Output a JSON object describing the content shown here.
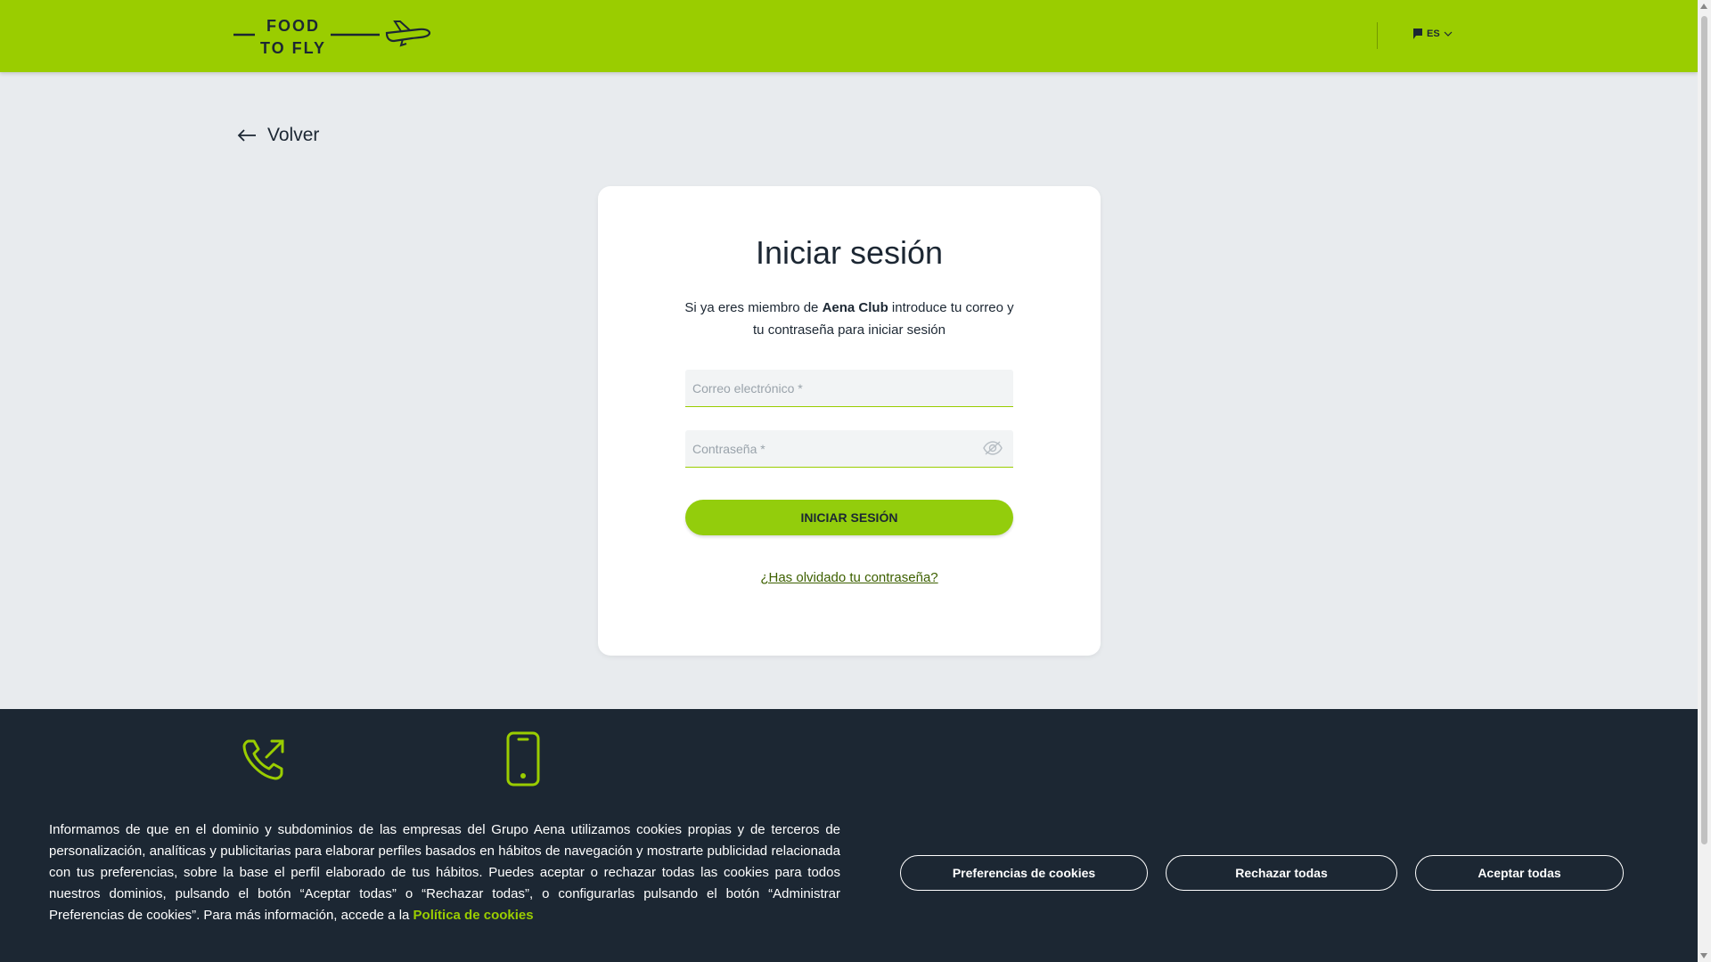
{
  "header": {
    "logo_line1": "FOOD",
    "logo_line2": "TO FLY",
    "language": "ES"
  },
  "back_label": "Volver",
  "login": {
    "title": "Iniciar sesión",
    "desc_before": "Si ya eres miembro de ",
    "desc_brand": "Aena Club",
    "desc_after": " introduce tu correo y tu contraseña para iniciar sesión",
    "email_placeholder": "Correo electrónico *",
    "password_placeholder": "Contraseña *",
    "submit_label": "INICIAR SESIÓN",
    "forgot_label": "¿Has olvidado tu contraseña?"
  },
  "cookies": {
    "text": "Informamos de que en el dominio y subdominios de las empresas del Grupo Aena utilizamos cookies propias y de terceros de personalización, analíticas y publicitarias para elaborar perfiles basados en hábitos de navegación y mostrarte publicidad relacionada con tus preferencias, sobre la base el perfil elaborado de tus hábitos. Puedes aceptar o rechazar todas las cookies para todos nuestros dominios, pulsando el botón “Aceptar todas” o “Rechazar todas”, o configurarlas pulsando el botón “Administrar Preferencias de cookies”. Para más información, accede a la ",
    "policy_link": "Política de cookies",
    "prefs_label": "Preferencias de cookies",
    "reject_label": "Rechazar todas",
    "accept_label": "Aceptar todas"
  },
  "colors": {
    "brand": "#9acd00",
    "footer": "#1c2733",
    "background": "#e8ebee"
  }
}
